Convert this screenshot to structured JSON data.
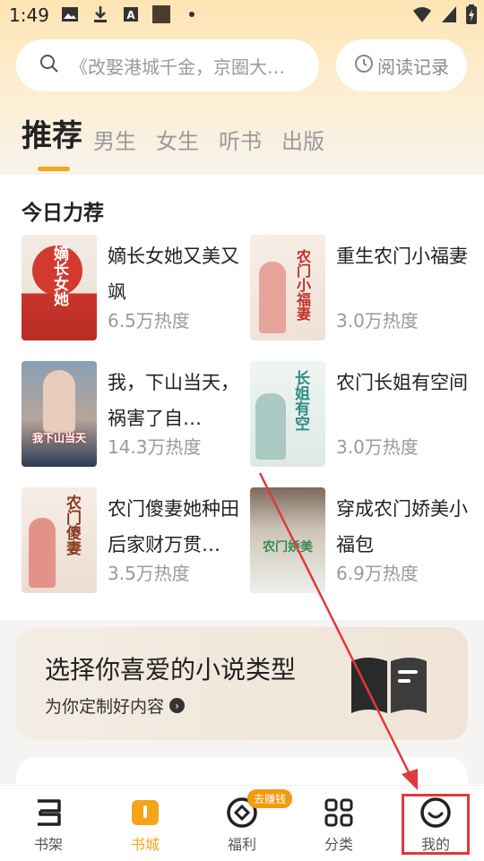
{
  "status_bar": {
    "time": "1:49"
  },
  "search": {
    "placeholder": "《改娶港城千金，京圈大…",
    "history_label": "阅读记录"
  },
  "tabs": [
    {
      "label": "推荐",
      "active": true
    },
    {
      "label": "男生"
    },
    {
      "label": "女生"
    },
    {
      "label": "听书"
    },
    {
      "label": "出版"
    }
  ],
  "section": {
    "title": "今日力荐"
  },
  "books": [
    {
      "title": "嫡长女她又美又飒",
      "heat": "6.5万热度",
      "cover_text": "嫡长女她",
      "cover_bg": "#c9342a"
    },
    {
      "title": "重生农门小福妻",
      "heat": "3.0万热度",
      "cover_text": "农门小福妻",
      "cover_bg": "#f0e6dc"
    },
    {
      "title": "我，下山当天，祸害了自…",
      "heat": "14.3万热度",
      "cover_text": "我下山当天",
      "cover_bg": "#5a6b7a"
    },
    {
      "title": "农门长姐有空间",
      "heat": "3.0万热度",
      "cover_text": "长姐有空",
      "cover_bg": "#e8f0ee"
    },
    {
      "title": "农门傻妻她种田后家财万贯…",
      "heat": "3.5万热度",
      "cover_text": "农门傻妻",
      "cover_bg": "#f3e9e0"
    },
    {
      "title": "穿成农门娇美小福包",
      "heat": "6.9万热度",
      "cover_text": "农门娇美",
      "cover_bg": "#e9ece6"
    }
  ],
  "banner": {
    "title": "选择你喜爱的小说类型",
    "subtitle": "为你定制好内容"
  },
  "bottom_nav": [
    {
      "label": "书架",
      "icon": "bookshelf-icon"
    },
    {
      "label": "书城",
      "icon": "bookstore-icon",
      "active": true
    },
    {
      "label": "福利",
      "icon": "welfare-icon",
      "badge": "去赚钱"
    },
    {
      "label": "分类",
      "icon": "category-icon"
    },
    {
      "label": "我的",
      "icon": "profile-icon"
    }
  ],
  "colors": {
    "accent": "#f5a51a",
    "annotation": "#e0393e"
  }
}
